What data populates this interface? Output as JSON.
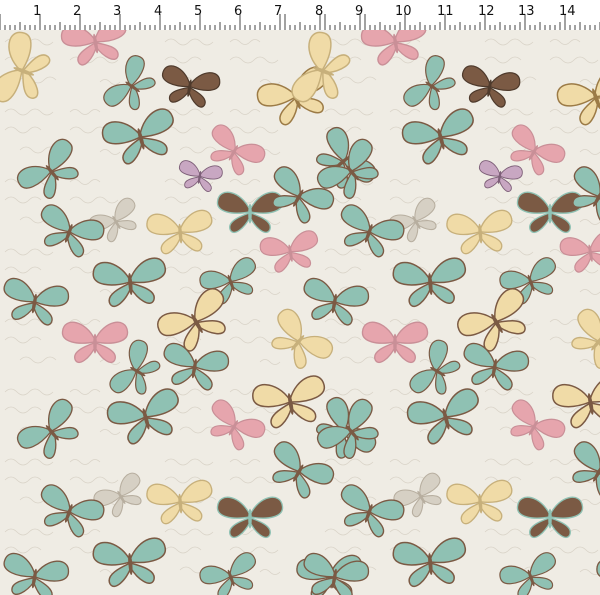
{
  "ruler": {
    "numbers": [
      "1",
      "2",
      "3",
      "4",
      "5",
      "6",
      "7",
      "8",
      "9",
      "10",
      "11",
      "12",
      "13",
      "14"
    ],
    "unit": "inch"
  },
  "fabric": {
    "pattern": "vintage butterflies on script background",
    "colors": {
      "background": "#efece4",
      "pink": "#e6a5ad",
      "teal": "#8fc1b3",
      "brown": "#7b5a44",
      "cream": "#f0dba7",
      "gray": "#d6d0c4",
      "lilac": "#c8a7c2"
    }
  }
}
